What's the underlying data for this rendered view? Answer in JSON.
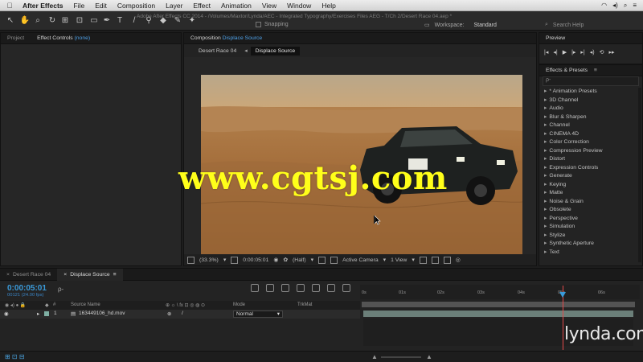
{
  "menubar": {
    "apple": "",
    "items": [
      "After Effects",
      "File",
      "Edit",
      "Composition",
      "Layer",
      "Effect",
      "Animation",
      "View",
      "Window",
      "Help"
    ]
  },
  "toolbar": {
    "doc_title": "Adobe After Effects CC 2014 - /Volumes/Maxtor/Lynda/AEC - Integrated Typography/Exercises Files AEG - T/Ch 2/Desert Race 04.aep *",
    "snapping_label": "Snapping",
    "workspace_label": "Workspace:",
    "workspace_value": "Standard",
    "search_label": "Search Help"
  },
  "left_panel": {
    "tab_project": "Project",
    "tab_effect_controls": "Effect Controls",
    "tab_effect_controls_value": "(none)"
  },
  "composition": {
    "tab_label": "Composition",
    "tab_value": "Displace Source",
    "subtabs": [
      "Desert Race 04",
      "Displace Source"
    ],
    "bottom_bar": {
      "zoom": "(33.3%)",
      "timecode": "0:00:05:01",
      "resolution": "(Half)",
      "camera": "Active Camera",
      "view": "1 View"
    }
  },
  "preview_panel": {
    "title": "Preview"
  },
  "effects_panel": {
    "title": "Effects & Presets",
    "search_placeholder": "ρ-",
    "items": [
      "* Animation Presets",
      "3D Channel",
      "Audio",
      "Blur & Sharpen",
      "Channel",
      "CINEMA 4D",
      "Color Correction",
      "Compression Preview",
      "Distort",
      "Expression Controls",
      "Generate",
      "Keying",
      "Matte",
      "Noise & Grain",
      "Obsolete",
      "Perspective",
      "Simulation",
      "Stylize",
      "Synthetic Aperture",
      "Text"
    ]
  },
  "timeline": {
    "tabs": [
      "Desert Race 04",
      "Displace Source"
    ],
    "timecode": "0:00:05:01",
    "fps": "00121 (24.00 fps)",
    "search": "ρ-",
    "columns": {
      "source_name": "Source Name",
      "mode": "Mode",
      "trkmat": "TrkMat"
    },
    "layer": {
      "index": "1",
      "name": "163449106_hd.mov",
      "mode": "Normal"
    },
    "ruler_labels": [
      "0s",
      "01s",
      "02s",
      "03s",
      "04s",
      "05s",
      "06s"
    ]
  },
  "overlay": {
    "watermark": "www.cgtsj.com",
    "brand": "lynda.com"
  }
}
